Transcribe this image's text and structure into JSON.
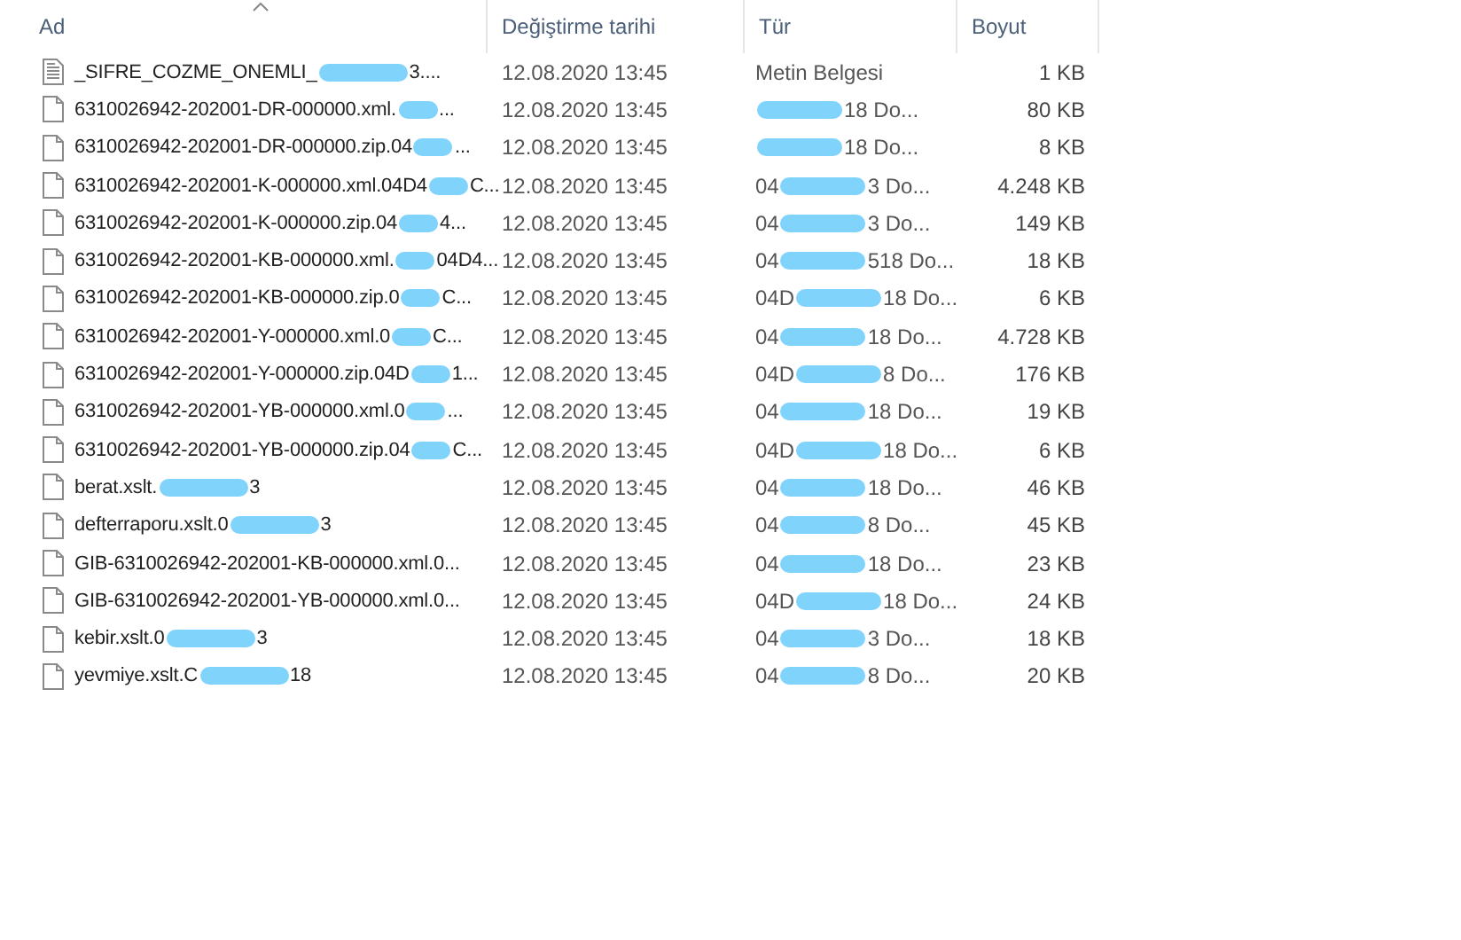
{
  "columns": [
    {
      "label": "Ad",
      "sorted": true
    },
    {
      "label": "Değiştirme tarihi",
      "sorted": false
    },
    {
      "label": "Tür",
      "sorted": false
    },
    {
      "label": "Boyut",
      "sorted": false
    }
  ],
  "files": [
    {
      "kind": "text",
      "name": {
        "head": "_SIFRE_COZME_ONEMLI_",
        "tail": "3...."
      },
      "date": "12.08.2020 13:45",
      "type": {
        "head": "Metin Belgesi"
      },
      "size": "1 KB"
    },
    {
      "kind": "file",
      "name": {
        "head": "6310026942-202001-DR-000000.xml.",
        "tail": "..."
      },
      "date": "12.08.2020 13:45",
      "type": {
        "tail": "18 Do..."
      },
      "size": "80 KB"
    },
    {
      "kind": "file",
      "name": {
        "head": "6310026942-202001-DR-000000.zip.04",
        "tail": "..."
      },
      "date": "12.08.2020 13:45",
      "type": {
        "tail": "18 Do..."
      },
      "size": "8 KB"
    },
    {
      "kind": "file",
      "name": {
        "head": "6310026942-202001-K-000000.xml.04D4",
        "tail": "C..."
      },
      "date": "12.08.2020 13:45",
      "type": {
        "head": "04",
        "tail": "3 Do..."
      },
      "size": "4.248 KB"
    },
    {
      "kind": "file",
      "name": {
        "head": "6310026942-202001-K-000000.zip.04",
        "tail": "4..."
      },
      "date": "12.08.2020 13:45",
      "type": {
        "head": "04",
        "tail": "3 Do..."
      },
      "size": "149 KB"
    },
    {
      "kind": "file",
      "name": {
        "head": "6310026942-202001-KB-000000.xml.",
        "tail": "04D4..."
      },
      "date": "12.08.2020 13:45",
      "type": {
        "head": "04",
        "tail": "518 Do..."
      },
      "size": "18 KB"
    },
    {
      "kind": "file",
      "name": {
        "head": "6310026942-202001-KB-000000.zip.0",
        "tail": "C..."
      },
      "date": "12.08.2020 13:45",
      "type": {
        "head": "04D",
        "tail": "18 Do..."
      },
      "size": "6 KB"
    },
    {
      "kind": "file",
      "name": {
        "head": "6310026942-202001-Y-000000.xml.0",
        "tail": "C..."
      },
      "date": "12.08.2020 13:45",
      "type": {
        "head": "04",
        "tail": "18 Do..."
      },
      "size": "4.728 KB"
    },
    {
      "kind": "file",
      "name": {
        "head": "6310026942-202001-Y-000000.zip.04D",
        "tail": "1..."
      },
      "date": "12.08.2020 13:45",
      "type": {
        "head": "04D",
        "tail": "8 Do..."
      },
      "size": "176 KB"
    },
    {
      "kind": "file",
      "name": {
        "head": "6310026942-202001-YB-000000.xml.0",
        "tail": "..."
      },
      "date": "12.08.2020 13:45",
      "type": {
        "head": "04",
        "tail": "18 Do..."
      },
      "size": "19 KB"
    },
    {
      "kind": "file",
      "name": {
        "head": "6310026942-202001-YB-000000.zip.04",
        "tail": "C..."
      },
      "date": "12.08.2020 13:45",
      "type": {
        "head": "04D",
        "tail": "18 Do..."
      },
      "size": "6 KB"
    },
    {
      "kind": "file",
      "name": {
        "head": "berat.xslt.",
        "tail": "3"
      },
      "date": "12.08.2020 13:45",
      "type": {
        "head": "04",
        "tail": "18 Do..."
      },
      "size": "46 KB"
    },
    {
      "kind": "file",
      "name": {
        "head": "defterraporu.xslt.0",
        "tail": "3"
      },
      "date": "12.08.2020 13:45",
      "type": {
        "head": "04",
        "tail": "8 Do..."
      },
      "size": "45 KB"
    },
    {
      "kind": "file",
      "name": {
        "head": "GIB-6310026942-202001-KB-000000.xml.0..."
      },
      "date": "12.08.2020 13:45",
      "type": {
        "head": "04",
        "tail": "18 Do..."
      },
      "size": "23 KB"
    },
    {
      "kind": "file",
      "name": {
        "head": "GIB-6310026942-202001-YB-000000.xml.0..."
      },
      "date": "12.08.2020 13:45",
      "type": {
        "head": "04D",
        "tail": "18 Do..."
      },
      "size": "24 KB"
    },
    {
      "kind": "file",
      "name": {
        "head": "kebir.xslt.0",
        "tail": "3"
      },
      "date": "12.08.2020 13:45",
      "type": {
        "head": "04",
        "tail": "3 Do..."
      },
      "size": "18 KB"
    },
    {
      "kind": "file",
      "name": {
        "head": "yevmiye.xslt.C",
        "tail": "18"
      },
      "date": "12.08.2020 13:45",
      "type": {
        "head": "04",
        "tail": "8 Do..."
      },
      "size": "20 KB"
    }
  ]
}
